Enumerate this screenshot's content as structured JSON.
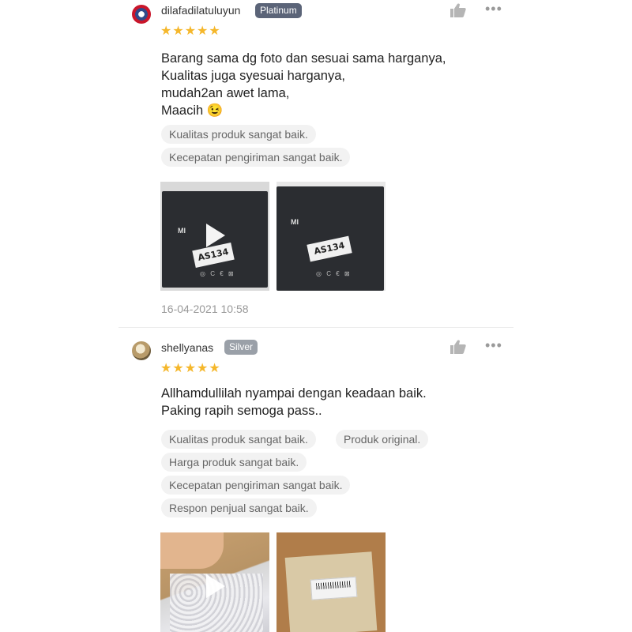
{
  "reviews": [
    {
      "username": "dilafadilatuluyun",
      "badge": "Platinum",
      "stars": "★★★★★",
      "comment": "Barang sama dg foto dan sesuai sama harganya,\nKualitas juga syesuai harganya,\nmudah2an awet lama,\nMaacih 😉",
      "tags": [
        "Kualitas produk sangat baik.",
        "Kecepatan pengiriman sangat baik."
      ],
      "images": [
        {
          "label": "AS134",
          "brand": "MI",
          "is_video": true
        },
        {
          "label": "AS134",
          "brand": "MI",
          "is_video": false
        }
      ],
      "timestamp": "16-04-2021 10:58"
    },
    {
      "username": "shellyanas",
      "badge": "Silver",
      "stars": "★★★★★",
      "comment": "Allhamdullilah nyampai dengan keadaan baik.\nPaking rapih semoga pass..",
      "tags": [
        "Kualitas produk sangat baik.",
        "Produk original.",
        "Harga produk sangat baik.",
        "Kecepatan pengiriman sangat baik.",
        "Respon penjual sangat baik."
      ],
      "images": [
        {
          "is_video": true
        },
        {
          "is_video": false
        }
      ]
    }
  ],
  "icons": {
    "like": "thumbs-up-icon",
    "more": "more-icon",
    "play": "play-icon"
  },
  "colors": {
    "star": "#f5b72b",
    "platinum_badge": "#5b6478",
    "silver_badge": "#9aa0a8",
    "tag_bg": "#f2f2f2"
  }
}
